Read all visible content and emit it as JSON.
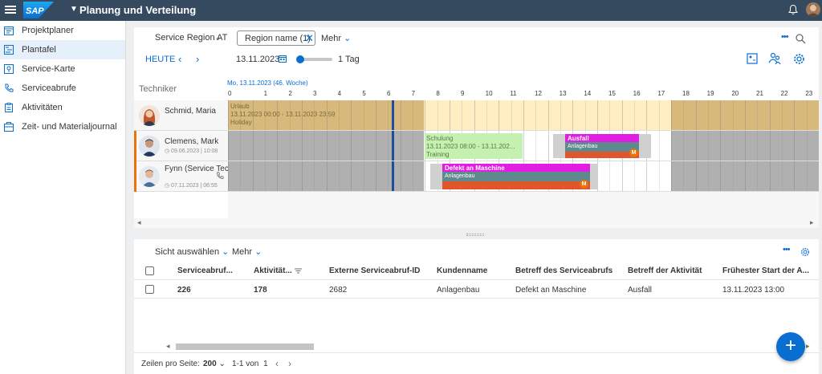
{
  "shell": {
    "logo": "SAP",
    "title": "Planung und Verteilung"
  },
  "sidebar": {
    "items": [
      {
        "label": "Projektplaner",
        "icon": "project-planner-icon"
      },
      {
        "label": "Plantafel",
        "icon": "planning-board-icon",
        "active": true
      },
      {
        "label": "Service-Karte",
        "icon": "map-icon"
      },
      {
        "label": "Serviceabrufe",
        "icon": "phone-icon"
      },
      {
        "label": "Aktivitäten",
        "icon": "activities-icon"
      },
      {
        "label": "Zeit- und Materialjournal",
        "icon": "journal-icon"
      }
    ]
  },
  "planner": {
    "filter_label": "Service Region AT",
    "filter_chip": "Region name (1)",
    "more_label": "Mehr",
    "today_label": "HEUTE",
    "date_value": "13.11.2023",
    "zoom_label": "1 Tag",
    "zoom_level": 0.0,
    "resource_header": "Techniker",
    "timeline_date": "Mo, 13.11.2023 (46. Woche)",
    "hours": [
      "0",
      "1",
      "2",
      "3",
      "4",
      "5",
      "6",
      "7",
      "8",
      "9",
      "10",
      "11",
      "12",
      "13",
      "14",
      "15",
      "16",
      "17",
      "18",
      "19",
      "20",
      "21",
      "22",
      "23"
    ],
    "technicians": [
      {
        "name": "Schmid, Maria",
        "sub": ""
      },
      {
        "name": "Clemens, Mark",
        "sub": "◷ 09.06.2023 | 10:08"
      },
      {
        "name": "Fynn (Service Techniker), T...",
        "sub": "◷ 07.11.2023 | 06:55"
      }
    ],
    "blocks": {
      "urlaub": {
        "title": "Urlaub",
        "time": "13.11.2023 00:00 - 13.11.2023 23:59",
        "type": "Holiday"
      },
      "schulung": {
        "title": "Schulung",
        "time": "13.11.2023 08:00 - 13.11.202...",
        "type": "Training"
      },
      "ausfall": {
        "title": "Ausfall",
        "customer": "Anlagenbau",
        "badge": "M"
      },
      "defekt": {
        "title": "Defekt an Maschine",
        "customer": "Anlagenbau",
        "badge": "M"
      }
    }
  },
  "list": {
    "view_select": "Sicht auswählen",
    "more_label": "Mehr",
    "columns": [
      "Serviceabruf...",
      "Aktivität...",
      "Externe Serviceabruf-ID",
      "Kundenname",
      "Betreff des Serviceabrufs",
      "Betreff der Aktivität",
      "Frühester Start der A..."
    ],
    "rows": [
      {
        "serviceabruf": "226",
        "aktivitaet": "178",
        "externe_id": "2682",
        "kunde": "Anlagenbau",
        "betreff_abruf": "Defekt an Maschine",
        "betreff_aktivitaet": "Ausfall",
        "start": "13.11.2023 13:00"
      }
    ],
    "rows_per_page_label": "Zeilen pro Seite:",
    "rows_per_page_value": "200",
    "pagination": "1-1 von",
    "page_total": "1"
  },
  "colors": {
    "shell": "#354a5f",
    "accent": "#0a6ed1",
    "holiday": "#d6b97b",
    "training": "#c5f1b0",
    "task_magenta": "#e31ce3",
    "task_teal": "#5f8a8d",
    "task_orange": "#e0552b",
    "priority": "#e9730c"
  }
}
